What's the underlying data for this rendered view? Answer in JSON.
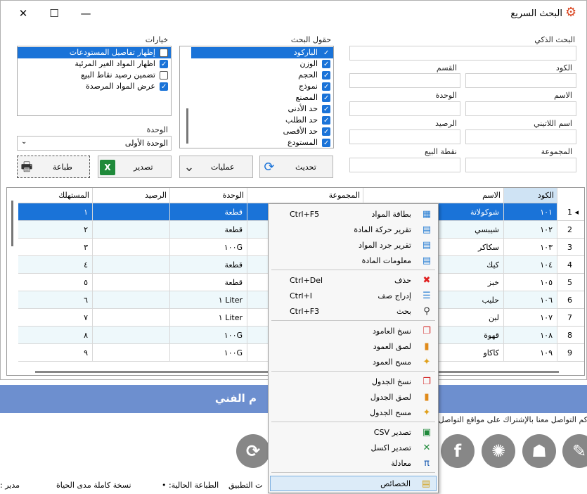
{
  "window": {
    "title": "البحث السريع",
    "minimize": "—",
    "maximize": "☐",
    "close": "✕"
  },
  "smart_search": {
    "label": "البحث الذكي"
  },
  "fields": {
    "code": "الكود",
    "section": "القسم",
    "name": "الاسم",
    "unit": "الوحدة",
    "latin_name": "اسم اللاتيني",
    "balance": "الرصيد",
    "group": "المجموعة",
    "sale_point": "نقطة البيع"
  },
  "search_fields": {
    "title": "حقول البحث",
    "items": [
      {
        "label": "الباركود",
        "checked": true,
        "selected": true
      },
      {
        "label": "الوزن",
        "checked": true
      },
      {
        "label": "الحجم",
        "checked": true
      },
      {
        "label": "نموذج",
        "checked": true
      },
      {
        "label": "المصنع",
        "checked": true
      },
      {
        "label": "حد الأدنى",
        "checked": true
      },
      {
        "label": "حد الطلب",
        "checked": true
      },
      {
        "label": "حد الأقصى",
        "checked": true
      },
      {
        "label": "المستودع",
        "checked": true
      }
    ]
  },
  "options": {
    "title": "خيارات",
    "items": [
      {
        "label": "إظهار تفاصيل المستودعات",
        "checked": false,
        "selected": true
      },
      {
        "label": "اظهار المواد الغير المرئية",
        "checked": true
      },
      {
        "label": "تضمين رصيد نقاط البيع",
        "checked": false
      },
      {
        "label": "عرض المواد المرصدة",
        "checked": true
      }
    ]
  },
  "unit_select": {
    "label": "الوحدة",
    "value": "الوحدة الأولى"
  },
  "buttons": {
    "print": "طباعة",
    "export": "تصدير",
    "operations": "عمليات",
    "refresh": "تحديث"
  },
  "grid": {
    "headers": {
      "code": "الكود",
      "name": "الاسم",
      "group": "المجموعة",
      "unit": "الوحدة",
      "balance": "الرصيد",
      "consumer": "المستهلك"
    },
    "rows": [
      {
        "num": "1",
        "code": "١٠١",
        "name": "شوكولاتة",
        "unit": "قطعة",
        "consumer": "١"
      },
      {
        "num": "2",
        "code": "١٠٢",
        "name": "شيبسي",
        "unit": "قطعة",
        "consumer": "٢"
      },
      {
        "num": "3",
        "code": "١٠٣",
        "name": "سكاكر",
        "unit": "١٠٠G",
        "consumer": "٣"
      },
      {
        "num": "4",
        "code": "١٠٤",
        "name": "كيك",
        "unit": "قطعة",
        "consumer": "٤"
      },
      {
        "num": "5",
        "code": "١٠٥",
        "name": "خبز",
        "unit": "قطعة",
        "consumer": "٥"
      },
      {
        "num": "6",
        "code": "١٠٦",
        "name": "حليب",
        "unit": "Liter ١",
        "consumer": "٦"
      },
      {
        "num": "7",
        "code": "١٠٧",
        "name": "لبن",
        "unit": "Liter ١",
        "consumer": "٧"
      },
      {
        "num": "8",
        "code": "١٠٨",
        "name": "قهوة",
        "unit": "١٠٠G",
        "consumer": "٨"
      },
      {
        "num": "9",
        "code": "١٠٩",
        "name": "كاكاو",
        "unit": "١٠٠G",
        "consumer": "٩"
      }
    ]
  },
  "context_menu": [
    {
      "label": "بطاقة المواد",
      "shortcut": "Ctrl+F5",
      "icon": "card-icon",
      "glyph": "▦",
      "color": "#2a7fd4"
    },
    {
      "label": "تقرير حركة المادة",
      "shortcut": "",
      "icon": "report-icon",
      "glyph": "▤",
      "color": "#2a7fd4"
    },
    {
      "label": "تقرير جرد المواد",
      "shortcut": "",
      "icon": "inventory-icon",
      "glyph": "▤",
      "color": "#2a7fd4"
    },
    {
      "label": "معلومات المادة",
      "shortcut": "",
      "icon": "info-icon",
      "glyph": "▤",
      "color": "#2a7fd4"
    },
    {
      "label": "حذف",
      "shortcut": "Ctrl+Del",
      "icon": "delete-icon",
      "glyph": "✖",
      "color": "#e02020"
    },
    {
      "label": "إدراج صف",
      "shortcut": "Ctrl+I",
      "icon": "insert-row-icon",
      "glyph": "☰",
      "color": "#2a7fd4"
    },
    {
      "label": "بحث",
      "shortcut": "Ctrl+F3",
      "icon": "search-icon",
      "glyph": "⚲",
      "color": "#333"
    },
    {
      "label": "نسخ العامود",
      "shortcut": "",
      "icon": "copy-icon",
      "glyph": "❐",
      "color": "#d42a2a"
    },
    {
      "label": "لصق العمود",
      "shortcut": "",
      "icon": "paste-icon",
      "glyph": "▮",
      "color": "#e08a1a"
    },
    {
      "label": "مسح العمود",
      "shortcut": "",
      "icon": "clear-icon",
      "glyph": "✦",
      "color": "#e0a01a"
    },
    {
      "label": "نسخ الجدول",
      "shortcut": "",
      "icon": "copy-table-icon",
      "glyph": "❐",
      "color": "#d42a2a"
    },
    {
      "label": "لصق الجدول",
      "shortcut": "",
      "icon": "paste-table-icon",
      "glyph": "▮",
      "color": "#e08a1a"
    },
    {
      "label": "مسح الجدول",
      "shortcut": "",
      "icon": "clear-table-icon",
      "glyph": "✦",
      "color": "#e0a01a"
    },
    {
      "label": "تصدير CSV",
      "shortcut": "",
      "icon": "csv-icon",
      "glyph": "▣",
      "color": "#1f8a3a"
    },
    {
      "label": "تصدير اكسل",
      "shortcut": "",
      "icon": "excel-icon",
      "glyph": "✕",
      "color": "#1f8a3a"
    },
    {
      "label": "معادلة",
      "shortcut": "",
      "icon": "formula-icon",
      "glyph": "π",
      "color": "#1f5fb4"
    },
    {
      "label": "الخصائص",
      "shortcut": "",
      "icon": "properties-icon",
      "glyph": "▤",
      "color": "#d4a21a"
    }
  ],
  "background": {
    "banner_text": "م الفني",
    "follow_text": "كم التواصل معنا بالإشتراك على مواقع التواصل ا",
    "social": [
      "tool-icon",
      "android-icon",
      "network-icon",
      "facebook-icon",
      "sync-icon"
    ]
  },
  "statusbar": {
    "manager": "مدير :",
    "license": "نسخة كاملة مدى الحياة",
    "printing": "الطباعة الحالية: •",
    "app": "ت التطبيق"
  },
  "colors": {
    "accent": "#1a73d8",
    "banner": "#6d8fcf",
    "alt_row": "#eef8fb"
  }
}
